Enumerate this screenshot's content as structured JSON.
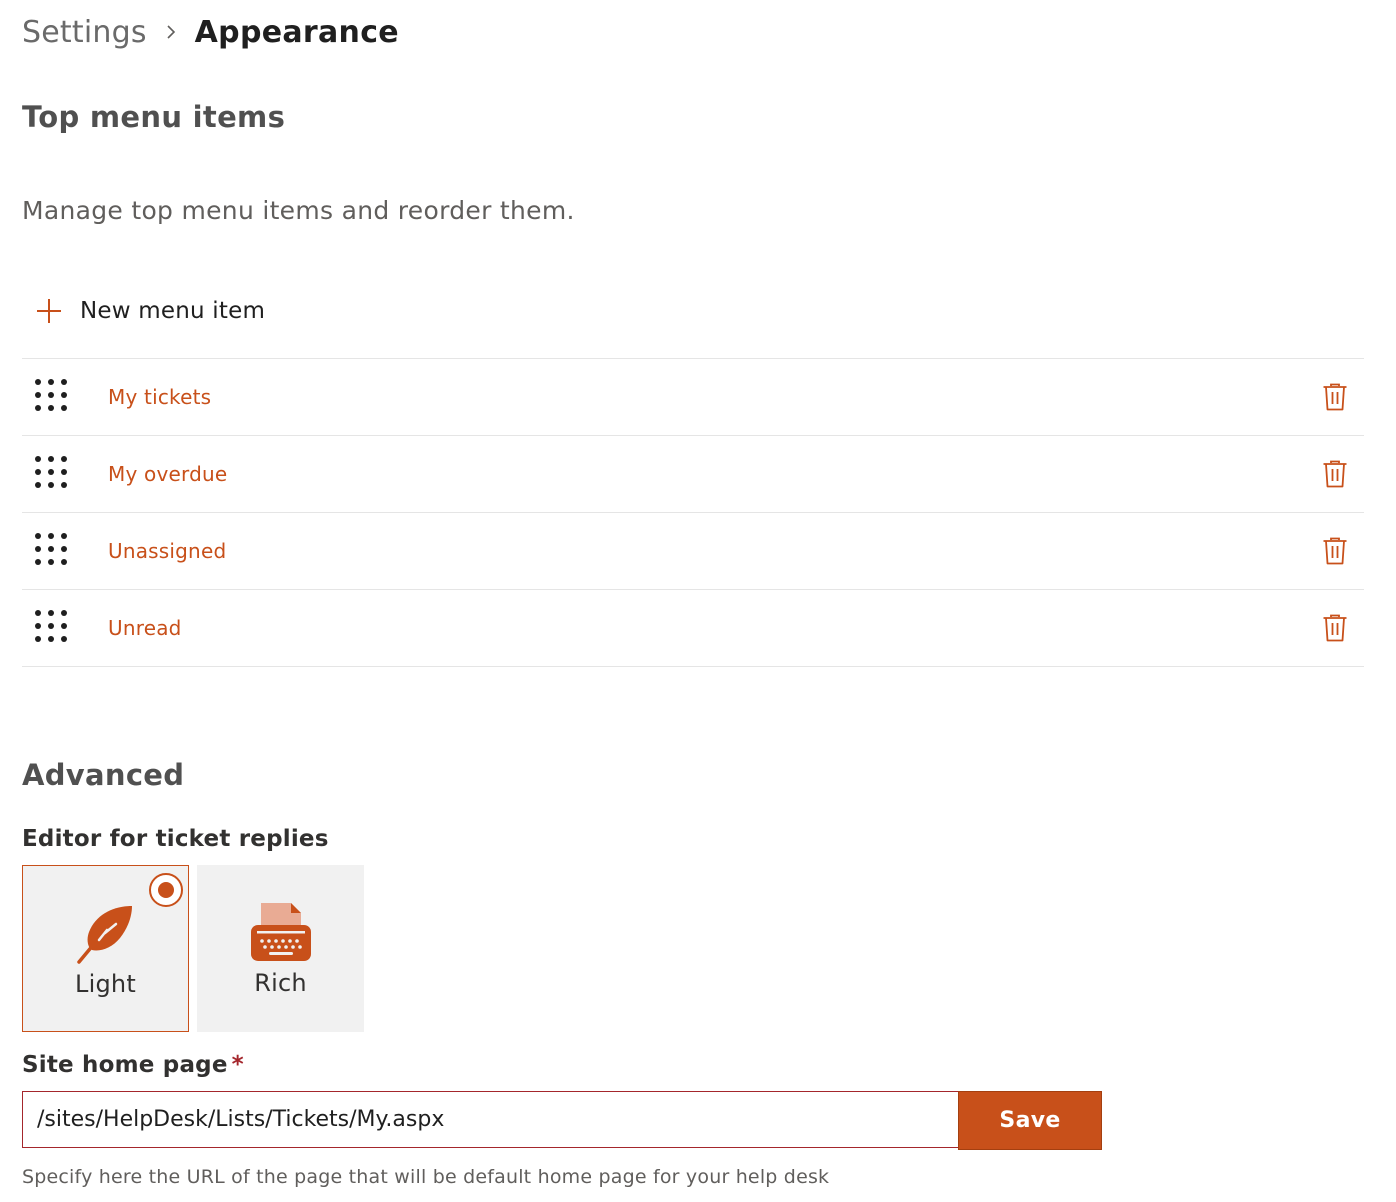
{
  "breadcrumb": {
    "root": "Settings",
    "current": "Appearance"
  },
  "top_menu": {
    "title": "Top menu items",
    "description": "Manage top menu items and reorder them.",
    "new_item_label": "New menu item",
    "items": [
      {
        "label": "My tickets"
      },
      {
        "label": "My overdue"
      },
      {
        "label": "Unassigned"
      },
      {
        "label": "Unread"
      }
    ]
  },
  "advanced": {
    "title": "Advanced",
    "editor": {
      "label": "Editor for ticket replies",
      "options": [
        {
          "label": "Light",
          "selected": true,
          "icon": "feather-icon"
        },
        {
          "label": "Rich",
          "selected": false,
          "icon": "typewriter-icon"
        }
      ]
    },
    "home_page": {
      "label": "Site home page",
      "required_mark": "*",
      "value": "/sites/HelpDesk/Lists/Tickets/My.aspx",
      "save_label": "Save",
      "hint": "Specify here the URL of the page that will be default home page for your help desk"
    }
  },
  "colors": {
    "accent": "#c8501a",
    "required": "#a4262c"
  }
}
